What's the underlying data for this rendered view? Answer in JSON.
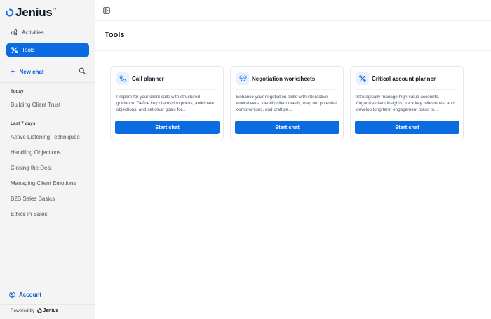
{
  "brand": {
    "name": "Jenius",
    "tm": "™",
    "accent": "#0b6be0"
  },
  "sidebar": {
    "nav": [
      {
        "label": "Activities",
        "icon": "activities-icon",
        "active": false
      },
      {
        "label": "Tools",
        "icon": "tools-icon",
        "active": true
      }
    ],
    "new_chat_label": "New chat",
    "today_label": "Today",
    "today_items": [
      "Building Client Trust"
    ],
    "last7_label": "Last 7 days",
    "last7_items": [
      "Active Listening Techniques",
      "Handling Objections",
      "Closing the Deal",
      "Managing Client Emotions",
      "B2B Sales Basics",
      "Ethics in Sales"
    ],
    "account_label": "Account",
    "powered_label": "Powered by",
    "powered_brand": "Jenius"
  },
  "main": {
    "title": "Tools",
    "cards": [
      {
        "title": "Call planner",
        "icon": "phone-icon",
        "desc": "Prepare for your client calls with structured guidance. Define key discussion points, anticipate objections, and set clear goals for...",
        "button": "Start chat"
      },
      {
        "title": "Negotiation worksheets",
        "icon": "handshake-icon",
        "desc": "Enhance your negotiation skills with interactive worksheets. Identify client needs, map out potential compromises, and craft pe...",
        "button": "Start chat"
      },
      {
        "title": "Critical account planner",
        "icon": "tools-icon",
        "desc": "Strategically manage high-value accounts. Organize client insights, track key milestones, and develop long-term engagement plans to...",
        "button": "Start chat"
      }
    ]
  }
}
